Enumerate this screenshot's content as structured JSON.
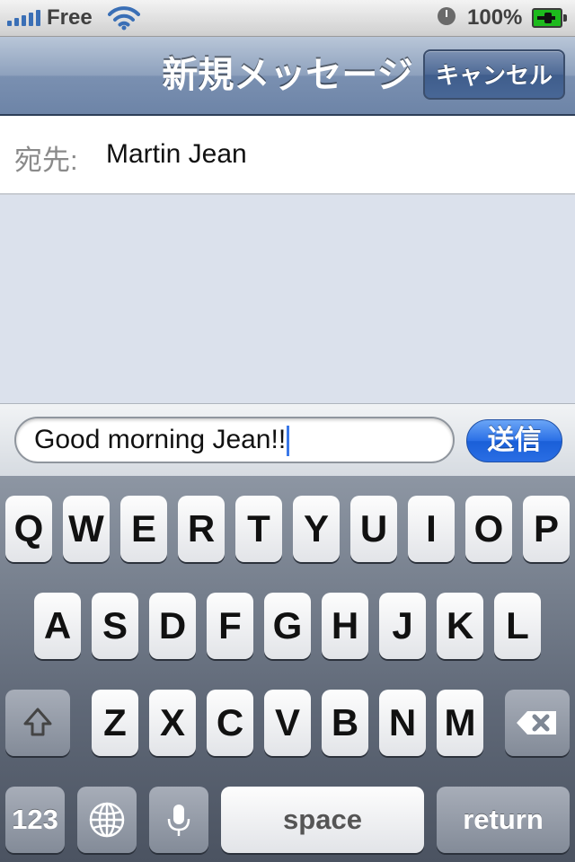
{
  "status_bar": {
    "carrier": "Free",
    "battery_percent": "100%",
    "signal_bars": 5,
    "icons": [
      "signal-icon",
      "wifi-icon",
      "clock-icon",
      "battery-charging-icon"
    ]
  },
  "nav": {
    "title": "新規メッセージ",
    "cancel_label": "キャンセル"
  },
  "to_field": {
    "label": "宛先:",
    "value": "Martin Jean"
  },
  "compose": {
    "input_value": "Good morning Jean!!",
    "send_label": "送信"
  },
  "keyboard": {
    "row1": [
      "Q",
      "W",
      "E",
      "R",
      "T",
      "Y",
      "U",
      "I",
      "O",
      "P"
    ],
    "row2": [
      "A",
      "S",
      "D",
      "F",
      "G",
      "H",
      "J",
      "K",
      "L"
    ],
    "row3": [
      "Z",
      "X",
      "C",
      "V",
      "B",
      "N",
      "M"
    ],
    "numbers_label": "123",
    "space_label": "space",
    "return_label": "return",
    "icons": [
      "shift-icon",
      "backspace-icon",
      "globe-icon",
      "microphone-icon"
    ]
  },
  "colors": {
    "nav_bar": "#7a90b1",
    "send_button": "#2a6fe6",
    "message_area": "#dbe1ec"
  }
}
